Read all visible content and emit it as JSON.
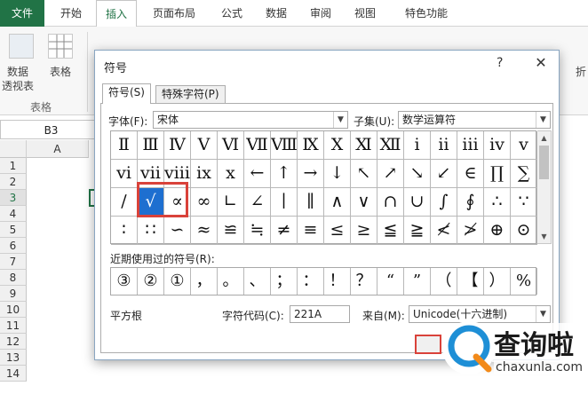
{
  "ribbon": {
    "tabs": [
      "文件",
      "开始",
      "插入",
      "页面布局",
      "公式",
      "数据",
      "审阅",
      "视图",
      "特色功能"
    ],
    "active_tab": "插入",
    "buttons": [
      "数据",
      "透视表",
      "表格"
    ],
    "group_label": "表格",
    "right_label": "折"
  },
  "sheet": {
    "name_box": "B3",
    "columns": [
      "A"
    ],
    "rows": [
      "1",
      "2",
      "3",
      "4",
      "5",
      "6",
      "7",
      "8",
      "9",
      "10",
      "11",
      "12",
      "13",
      "14"
    ],
    "selected_row": "3"
  },
  "dialog": {
    "title": "符号",
    "help": "?",
    "close": "✕",
    "tabs": [
      "符号(S)",
      "特殊字符(P)"
    ],
    "font_label": "字体(F):",
    "font_value": "宋体",
    "subset_label": "子集(U):",
    "subset_value": "数学运算符",
    "symbols": [
      [
        "Ⅱ",
        "Ⅲ",
        "Ⅳ",
        "Ⅴ",
        "Ⅵ",
        "Ⅶ",
        "Ⅷ",
        "Ⅸ",
        "Ⅹ",
        "Ⅺ",
        "Ⅻ",
        "ⅰ",
        "ⅱ",
        "ⅲ",
        "ⅳ",
        "ⅴ"
      ],
      [
        "ⅵ",
        "ⅶ",
        "ⅷ",
        "ⅸ",
        "ⅹ",
        "←",
        "↑",
        "→",
        "↓",
        "↖",
        "↗",
        "↘",
        "↙",
        "∈",
        "∏",
        "∑"
      ],
      [
        "∕",
        "√",
        "∝",
        "∞",
        "∟",
        "∠",
        "∣",
        "∥",
        "∧",
        "∨",
        "∩",
        "∪",
        "∫",
        "∮",
        "∴",
        "∵"
      ],
      [
        "∶",
        "∷",
        "∽",
        "≈",
        "≌",
        "≒",
        "≠",
        "≡",
        "≤",
        "≥",
        "≦",
        "≧",
        "≮",
        "≯",
        "⊕",
        "⊙"
      ]
    ],
    "selected_symbol": "√",
    "recent_label": "近期使用过的符号(R):",
    "recent_symbols": [
      "③",
      "②",
      "①",
      "，",
      "。",
      "、",
      "；",
      "：",
      "！",
      "？",
      "“",
      "”",
      "（",
      "【",
      "）",
      "%"
    ],
    "symbol_name": "平方根",
    "code_label": "字符代码(C):",
    "code_value": "221A",
    "from_label": "来自(M):",
    "from_value": "Unicode(十六进制)"
  },
  "watermark": {
    "brand": "查询啦",
    "domain": "chaxunla.com",
    "accent": "#1e8fd6"
  }
}
